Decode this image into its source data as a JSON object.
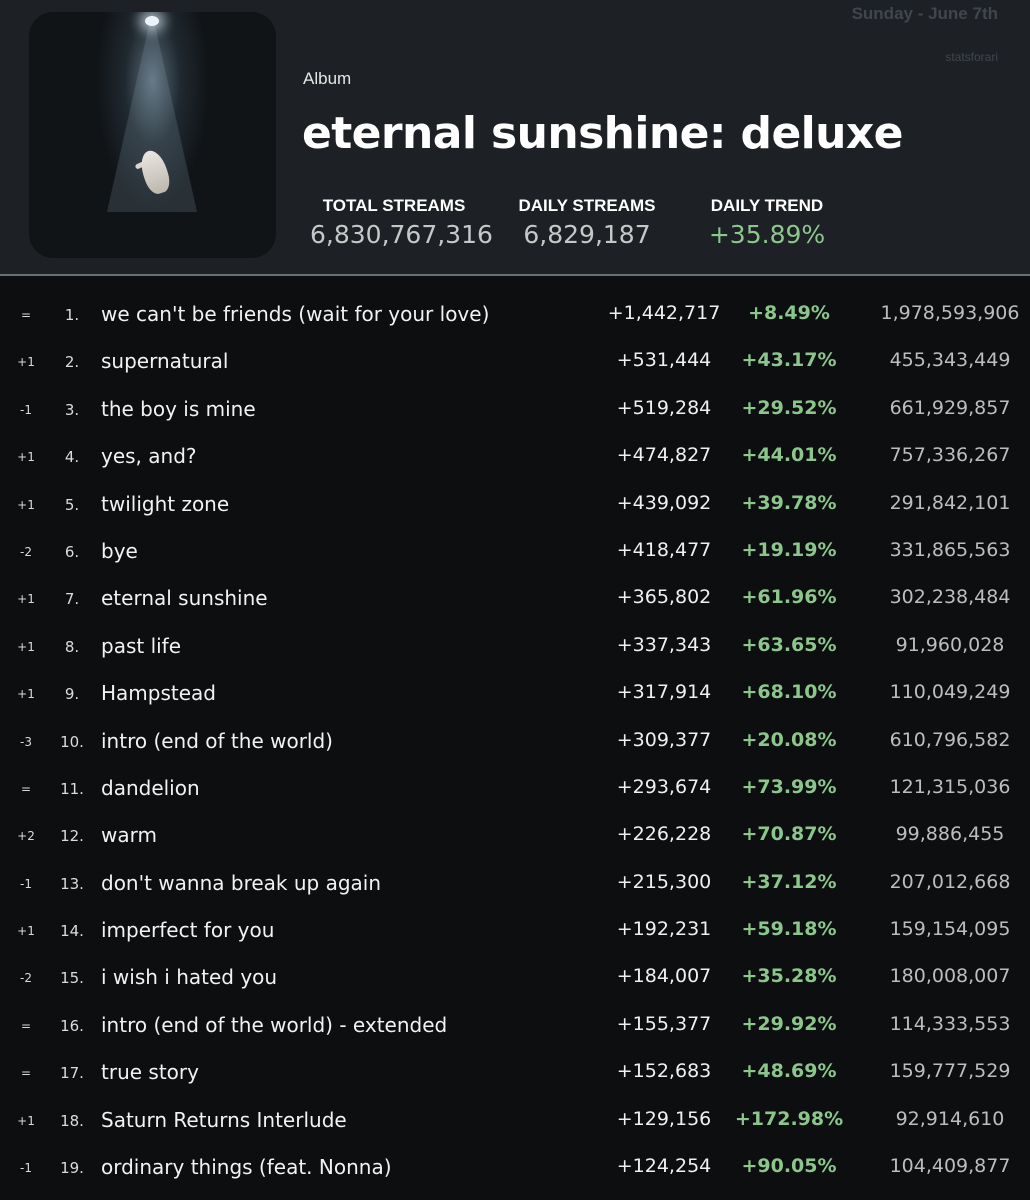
{
  "header": {
    "date": "Sunday - June 7th",
    "source": "statsforari",
    "kind": "Album",
    "title": "eternal sunshine: deluxe",
    "stats": [
      {
        "label": "TOTAL STREAMS",
        "value": "6,830,767,316"
      },
      {
        "label": "DAILY STREAMS",
        "value": "6,829,187"
      },
      {
        "label": "DAILY TREND",
        "value": "+35.89%"
      }
    ]
  },
  "tracks": [
    {
      "change": "=",
      "rank": "1.",
      "name": "we can't be friends (wait for your love)",
      "daily": "+1,442,717",
      "pct": "+8.49%",
      "total": "1,978,593,906"
    },
    {
      "change": "+1",
      "rank": "2.",
      "name": "supernatural",
      "daily": "+531,444",
      "pct": "+43.17%",
      "total": "455,343,449"
    },
    {
      "change": "-1",
      "rank": "3.",
      "name": "the boy is mine",
      "daily": "+519,284",
      "pct": "+29.52%",
      "total": "661,929,857"
    },
    {
      "change": "+1",
      "rank": "4.",
      "name": "yes, and?",
      "daily": "+474,827",
      "pct": "+44.01%",
      "total": "757,336,267"
    },
    {
      "change": "+1",
      "rank": "5.",
      "name": "twilight zone",
      "daily": "+439,092",
      "pct": "+39.78%",
      "total": "291,842,101"
    },
    {
      "change": "-2",
      "rank": "6.",
      "name": "bye",
      "daily": "+418,477",
      "pct": "+19.19%",
      "total": "331,865,563"
    },
    {
      "change": "+1",
      "rank": "7.",
      "name": "eternal sunshine",
      "daily": "+365,802",
      "pct": "+61.96%",
      "total": "302,238,484"
    },
    {
      "change": "+1",
      "rank": "8.",
      "name": "past life",
      "daily": "+337,343",
      "pct": "+63.65%",
      "total": "91,960,028"
    },
    {
      "change": "+1",
      "rank": "9.",
      "name": "Hampstead",
      "daily": "+317,914",
      "pct": "+68.10%",
      "total": "110,049,249"
    },
    {
      "change": "-3",
      "rank": "10.",
      "name": "intro (end of the world)",
      "daily": "+309,377",
      "pct": "+20.08%",
      "total": "610,796,582"
    },
    {
      "change": "=",
      "rank": "11.",
      "name": "dandelion",
      "daily": "+293,674",
      "pct": "+73.99%",
      "total": "121,315,036"
    },
    {
      "change": "+2",
      "rank": "12.",
      "name": "warm",
      "daily": "+226,228",
      "pct": "+70.87%",
      "total": "99,886,455"
    },
    {
      "change": "-1",
      "rank": "13.",
      "name": "don't wanna break up again",
      "daily": "+215,300",
      "pct": "+37.12%",
      "total": "207,012,668"
    },
    {
      "change": "+1",
      "rank": "14.",
      "name": "imperfect for you",
      "daily": "+192,231",
      "pct": "+59.18%",
      "total": "159,154,095"
    },
    {
      "change": "-2",
      "rank": "15.",
      "name": "i wish i hated you",
      "daily": "+184,007",
      "pct": "+35.28%",
      "total": "180,008,007"
    },
    {
      "change": "=",
      "rank": "16.",
      "name": "intro (end of the world) - extended",
      "daily": "+155,377",
      "pct": "+29.92%",
      "total": "114,333,553"
    },
    {
      "change": "=",
      "rank": "17.",
      "name": "true story",
      "daily": "+152,683",
      "pct": "+48.69%",
      "total": "159,777,529"
    },
    {
      "change": "+1",
      "rank": "18.",
      "name": "Saturn Returns Interlude",
      "daily": "+129,156",
      "pct": "+172.98%",
      "total": "92,914,610"
    },
    {
      "change": "-1",
      "rank": "19.",
      "name": "ordinary things (feat. Nonna)",
      "daily": "+124,254",
      "pct": "+90.05%",
      "total": "104,409,877"
    }
  ]
}
